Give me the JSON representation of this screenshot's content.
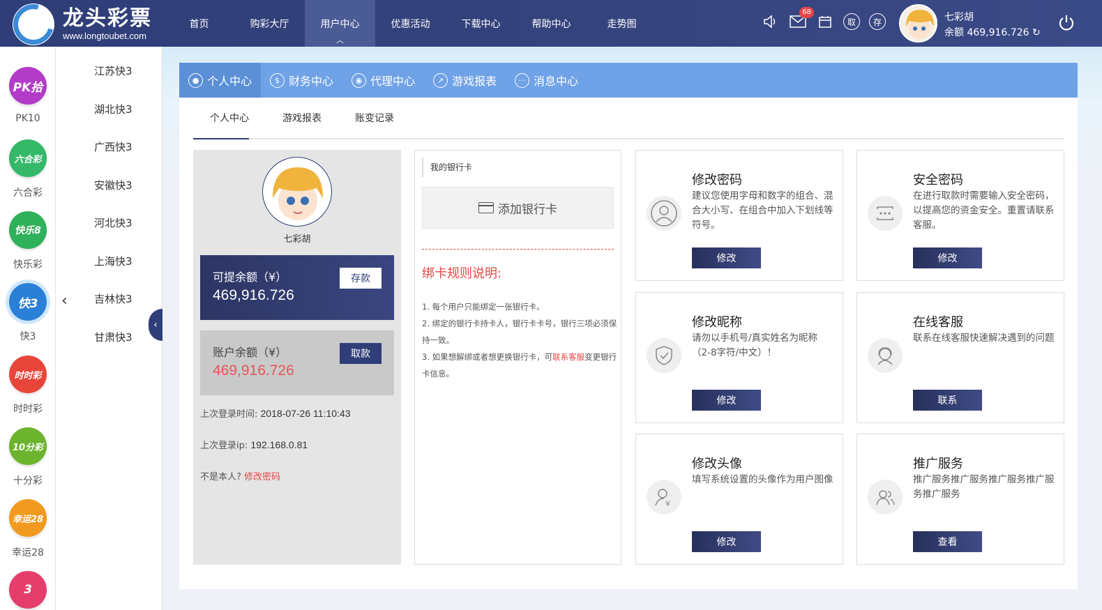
{
  "header": {
    "brand_title": "龙头彩票",
    "brand_url": "www.longtoubet.com",
    "nav": [
      "首页",
      "购彩大厅",
      "用户中心",
      "优惠活动",
      "下载中心",
      "帮助中心",
      "走势图"
    ],
    "active_nav": "用户中心",
    "mail_badge": "68",
    "icon_withdraw": "取",
    "icon_deposit": "存",
    "user_name": "七彩胡",
    "user_balance": "余额 469,916.726"
  },
  "lottery_list": [
    {
      "icon_text": "PK拾",
      "label": "PK10",
      "color": "#b23cc8"
    },
    {
      "icon_text": "六合彩",
      "label": "六合彩",
      "color": "#35b86a"
    },
    {
      "icon_text": "快乐8",
      "label": "快乐彩",
      "color": "#2fb05a"
    },
    {
      "icon_text": "快3",
      "label": "快3",
      "color": "#2a7fd6"
    },
    {
      "icon_text": "时时彩",
      "label": "时时彩",
      "color": "#e8463b"
    },
    {
      "icon_text": "10分彩",
      "label": "十分彩",
      "color": "#6cb32e"
    },
    {
      "icon_text": "幸运28",
      "label": "幸运28",
      "color": "#f29a1f"
    },
    {
      "icon_text": "3",
      "label": "",
      "color": "#e63e6c"
    }
  ],
  "sub_menu": [
    "江苏快3",
    "湖北快3",
    "广西快3",
    "安徽快3",
    "河北快3",
    "上海快3",
    "吉林快3",
    "甘肃快3"
  ],
  "tabs": [
    "个人中心",
    "财务中心",
    "代理中心",
    "游戏报表",
    "消息中心"
  ],
  "subtabs": [
    "个人中心",
    "游戏报表",
    "账变记录"
  ],
  "profile": {
    "name": "七彩胡",
    "withdrawable_title": "可提余额（¥）",
    "withdrawable_value": "469,916.726",
    "deposit_btn": "存款",
    "account_title": "账户余额（¥）",
    "account_value": "469,916.726",
    "withdraw_btn": "取款",
    "last_login_time_label": "上次登录时间: ",
    "last_login_time": "2018-07-26 11:10:43",
    "last_login_ip_label": "上次登录ip: ",
    "last_login_ip": "192.168.0.81",
    "not_me": "不是本人?",
    "change_pwd_link": "修改密码"
  },
  "bank": {
    "title": "我的银行卡",
    "add_card": "添加银行卡",
    "rule_title": "绑卡规则说明:",
    "rule1": "1. 每个用户只能绑定一张银行卡。",
    "rule2": "2. 绑定的银行卡持卡人，银行卡卡号，银行三项必须保持一致。",
    "rule3_a": "3. 如果想解绑或者想更换银行卡，可",
    "rule3_link": "联系客服",
    "rule3_b": "变更银行卡信息。"
  },
  "cards": [
    {
      "title": "修改密码",
      "desc": "建议您使用字母和数字的组合、混合大小写、在组合中加入下划线等符号。",
      "btn": "修改",
      "icon": "user-icon"
    },
    {
      "title": "安全密码",
      "desc": "在进行取款时需要输入安全密码，以提高您的资金安全。重置请联系客服。",
      "btn": "修改",
      "icon": "password-icon"
    },
    {
      "title": "修改昵称",
      "desc": "请勿以手机号/真实姓名为昵称（2-8字符/中文）！",
      "btn": "修改",
      "icon": "shield-icon"
    },
    {
      "title": "在线客服",
      "desc": "联系在线客服快速解决遇到的问题",
      "btn": "联系",
      "icon": "support-icon"
    },
    {
      "title": "修改头像",
      "desc": "填写系统设置的头像作为用户图像",
      "btn": "修改",
      "icon": "avatar-money-icon"
    },
    {
      "title": "推广服务",
      "desc": "推广服务推广服务推广服务推广服务推广服务",
      "btn": "查看",
      "icon": "group-icon"
    }
  ]
}
